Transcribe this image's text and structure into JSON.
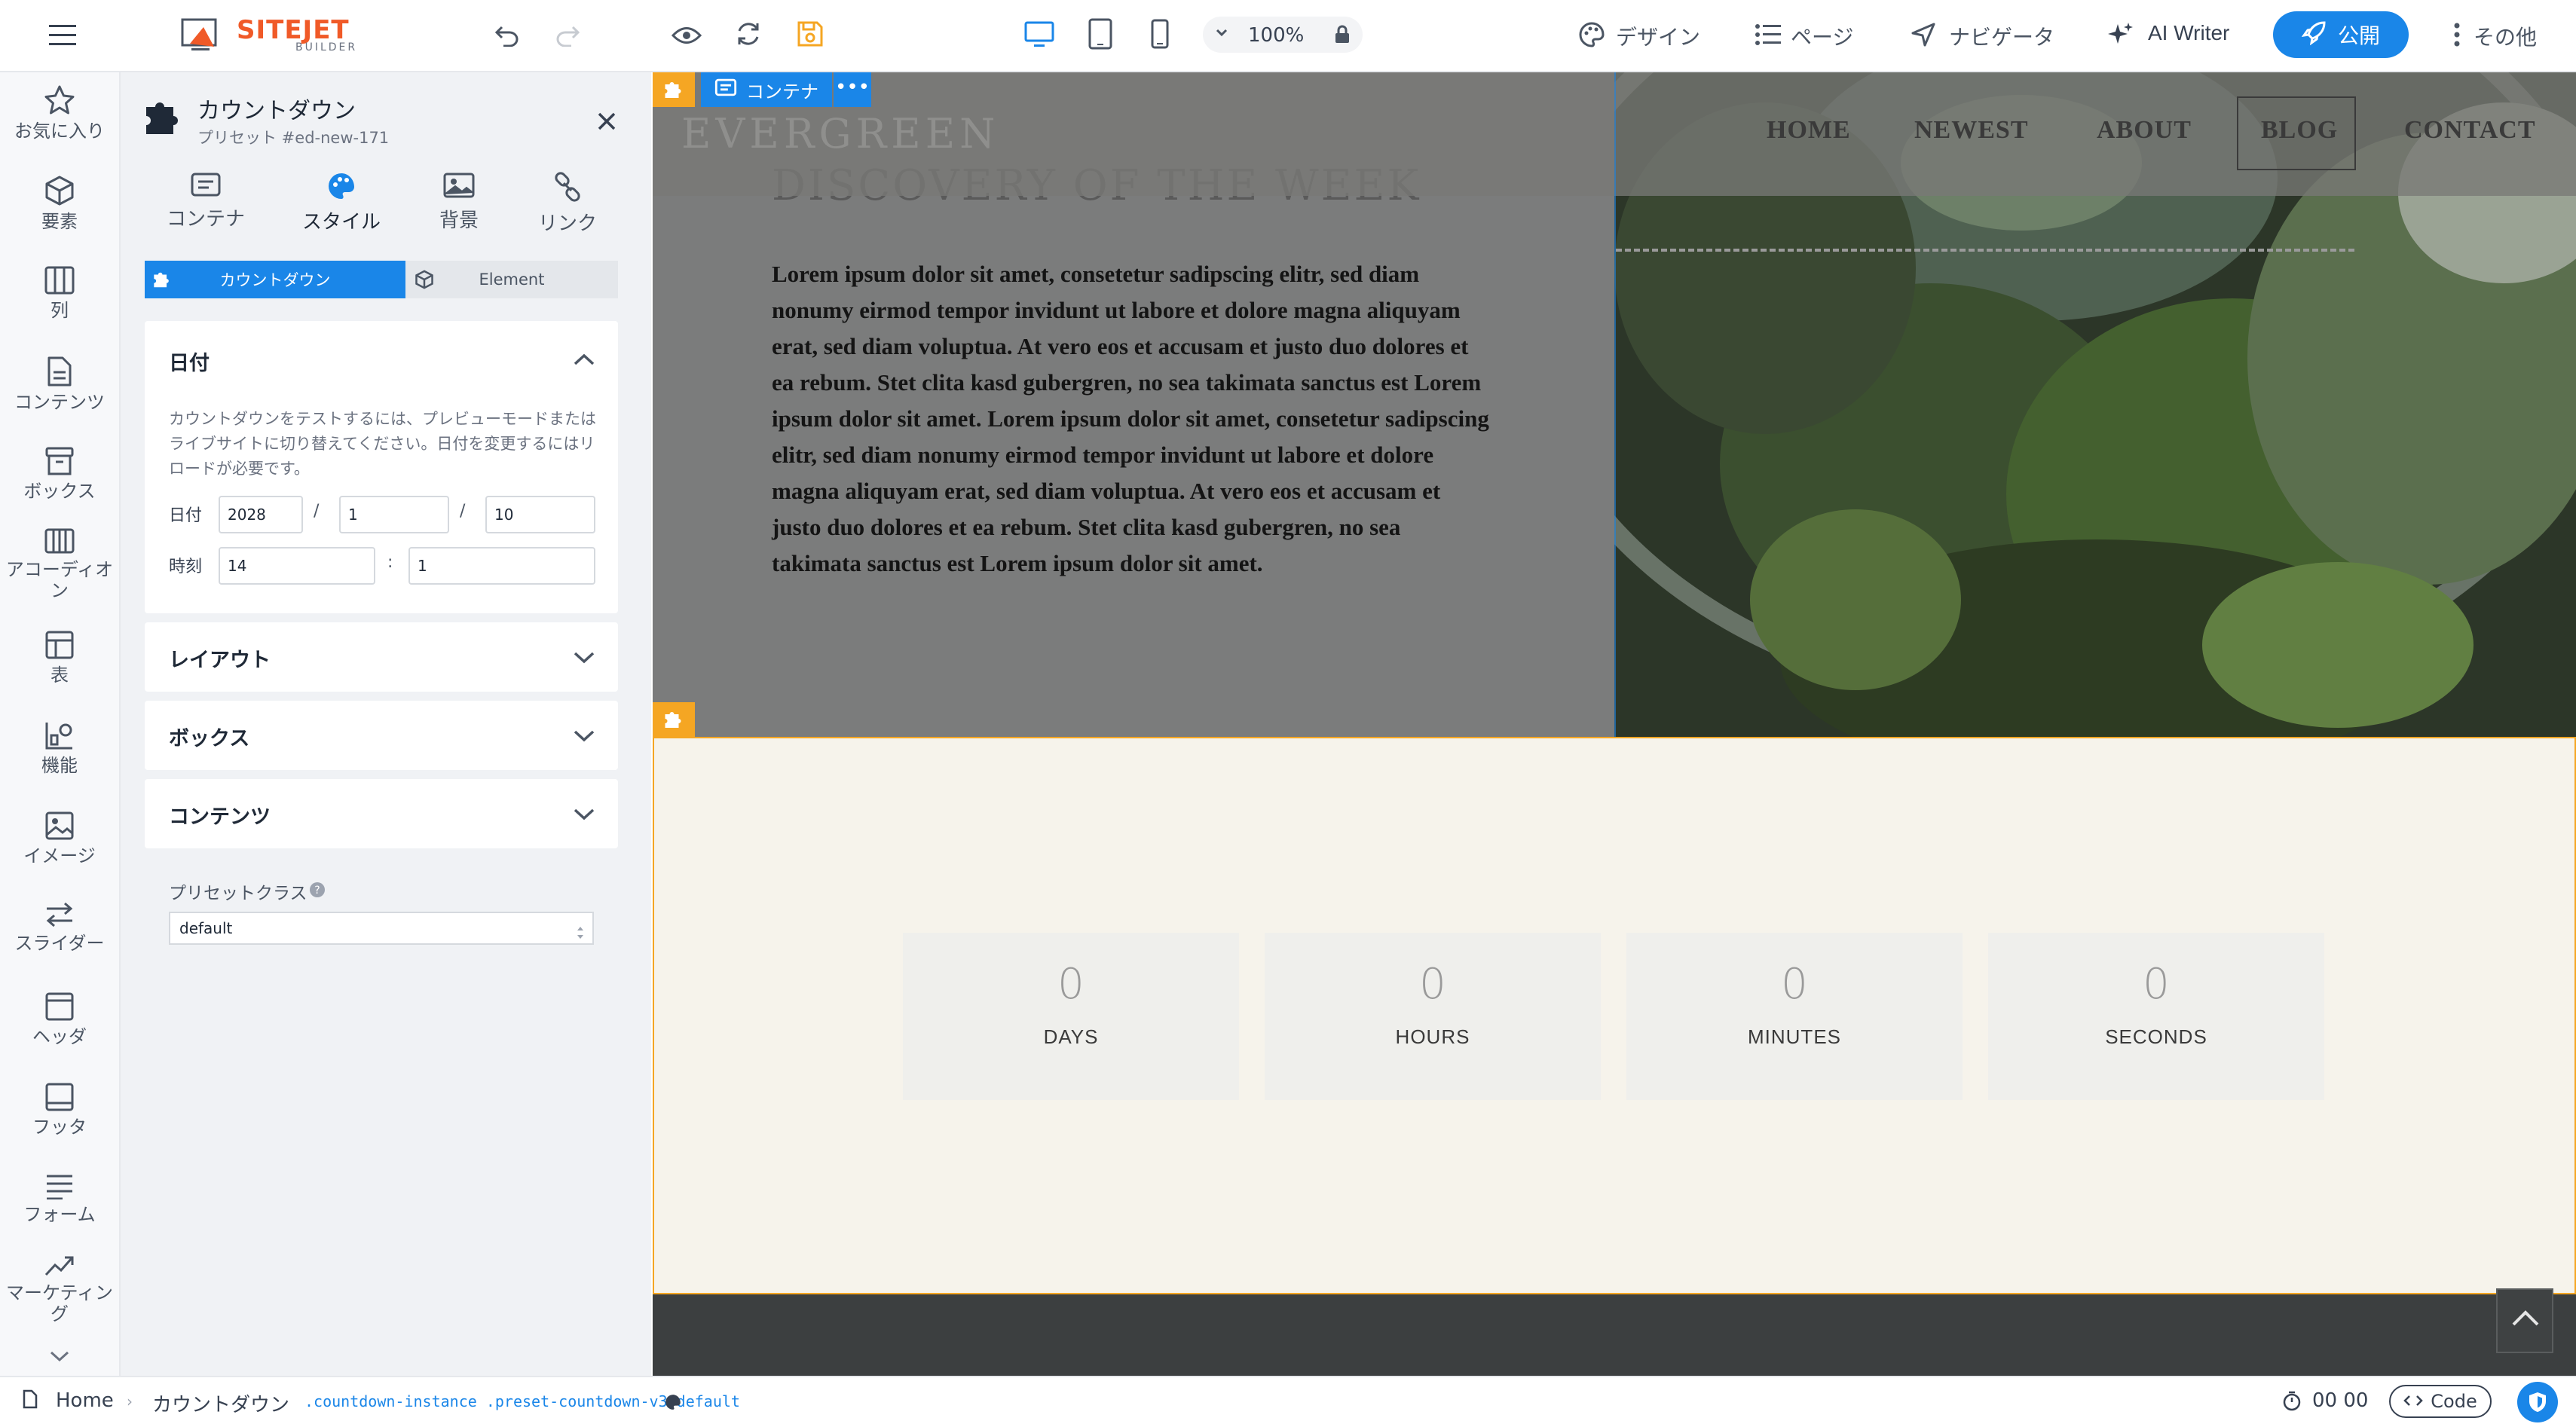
{
  "app": {
    "logo_main": "SITEJET",
    "logo_sub": "BUILDER",
    "zoom": "100%",
    "menu": {
      "design": "デザイン",
      "pages": "ページ",
      "navigator": "ナビゲータ",
      "ai_writer": "AI Writer",
      "publish": "公開",
      "more": "その他"
    }
  },
  "rail": {
    "items": [
      "お気に入り",
      "要素",
      "列",
      "コンテンツ",
      "ボックス",
      "アコーディオン",
      "表",
      "機能",
      "イメージ",
      "スライダー",
      "ヘッダ",
      "フッタ",
      "フォーム",
      "マーケティング"
    ]
  },
  "panel": {
    "title": "カウントダウン",
    "subtitle": "プリセット #ed-new-171",
    "tabs": [
      "コンテナ",
      "スタイル",
      "背景",
      "リンク"
    ],
    "segment": [
      "カウントダウン",
      "Element"
    ],
    "date_section": {
      "title": "日付",
      "help": "カウントダウンをテストするには、プレビューモードまたはライブサイトに切り替えてください。日付を変更するにはリロードが必要です。",
      "date_label": "日付",
      "year": "2028",
      "month": "1",
      "day": "10",
      "date_sep": "/",
      "time_label": "時刻",
      "hour": "14",
      "minute": "1",
      "time_sep": ":"
    },
    "sections": [
      "レイアウト",
      "ボックス",
      "コンテンツ"
    ],
    "preset_class_label": "プリセットクラス",
    "preset_class_value": "default"
  },
  "canvas": {
    "container_tag": "コンテナ",
    "container_more": "•••",
    "site": {
      "brand": "EVERGREEN",
      "nav": [
        "HOME",
        "NEWEST",
        "ABOUT",
        "BLOG",
        "CONTACT"
      ],
      "active_nav": "BLOG",
      "hero_heading": "DISCOVERY OF THE WEEK",
      "hero_body": "Lorem ipsum dolor sit amet, consetetur sadipscing elitr, sed diam nonumy eirmod tempor invidunt ut labore et dolore magna aliquyam erat, sed diam voluptua. At vero eos et accusam et justo duo dolores et ea rebum. Stet clita kasd gubergren, no sea takimata sanctus est Lorem ipsum dolor sit amet. Lorem ipsum dolor sit amet, consetetur sadipscing elitr, sed diam nonumy eirmod tempor invidunt ut labore et dolore magna aliquyam erat, sed diam voluptua. At vero eos et accusam et justo duo dolores et ea rebum. Stet clita kasd gubergren, no sea takimata sanctus est Lorem ipsum dolor sit amet."
    },
    "countdown": [
      {
        "value": "0",
        "label": "DAYS"
      },
      {
        "value": "0",
        "label": "HOURS"
      },
      {
        "value": "0",
        "label": "MINUTES"
      },
      {
        "value": "0",
        "label": "SECONDS"
      }
    ]
  },
  "statusbar": {
    "home": "Home",
    "crumb": "カウントダウン",
    "css_class": ".countdown-instance .preset-countdown-v3-default",
    "timer": "00 00",
    "code": "Code"
  },
  "colors": {
    "accent": "#1a86e8",
    "brand_orange": "#f05a28",
    "selection_orange": "#f5a623",
    "countdown_bg": "#f6f3eb"
  }
}
